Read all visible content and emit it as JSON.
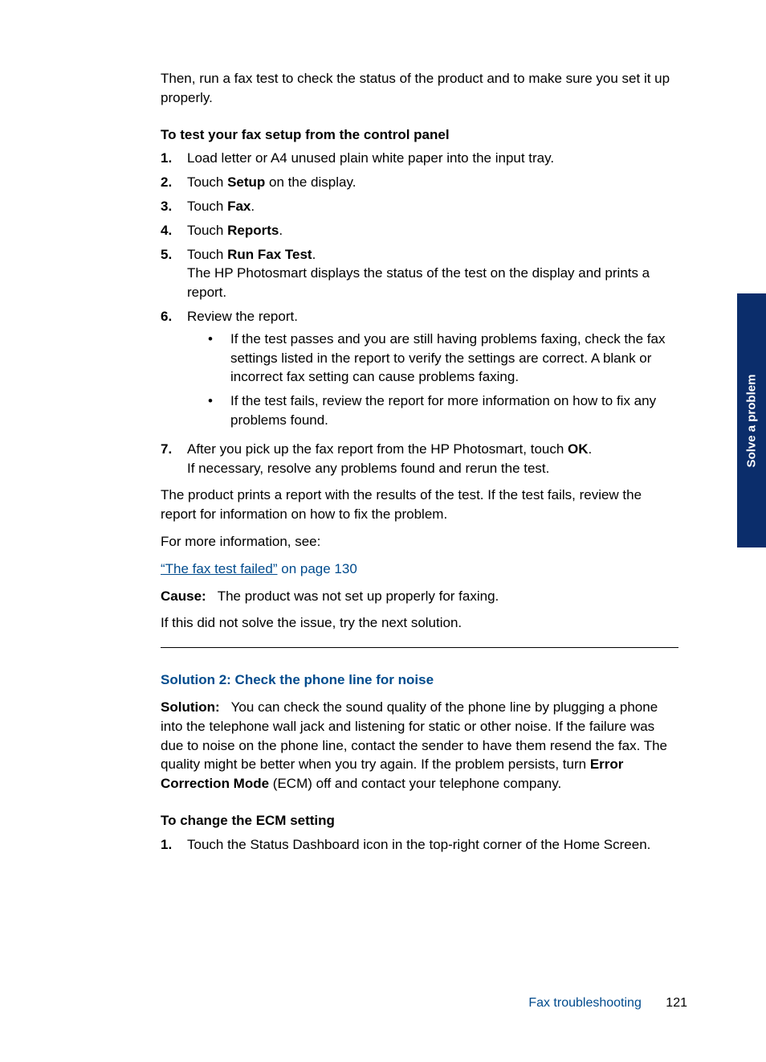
{
  "intro": "Then, run a fax test to check the status of the product and to make sure you set it up properly.",
  "heading1": "To test your fax setup from the control panel",
  "steps": [
    {
      "num": "1.",
      "parts": [
        "Load letter or A4 unused plain white paper into the input tray."
      ]
    },
    {
      "num": "2.",
      "parts": [
        "Touch ",
        "Setup",
        " on the display."
      ]
    },
    {
      "num": "3.",
      "parts": [
        "Touch ",
        "Fax",
        "."
      ]
    },
    {
      "num": "4.",
      "parts": [
        "Touch ",
        "Reports",
        "."
      ]
    },
    {
      "num": "5.",
      "parts": [
        "Touch ",
        "Run Fax Test",
        "."
      ],
      "after": "The HP Photosmart displays the status of the test on the display and prints a report."
    },
    {
      "num": "6.",
      "parts": [
        "Review the report."
      ],
      "bullets": [
        "If the test passes and you are still having problems faxing, check the fax settings listed in the report to verify the settings are correct. A blank or incorrect fax setting can cause problems faxing.",
        "If the test fails, review the report for more information on how to fix any problems found."
      ]
    },
    {
      "num": "7.",
      "parts": [
        "After you pick up the fax report from the HP Photosmart, touch ",
        "OK",
        "."
      ],
      "after": "If necessary, resolve any problems found and rerun the test."
    }
  ],
  "after_steps1": "The product prints a report with the results of the test. If the test fails, review the report for information on how to fix the problem.",
  "after_steps2": "For more information, see:",
  "link_text": "“The fax test failed”",
  "link_suffix": " on page 130",
  "cause_label": "Cause:",
  "cause_text": "The product was not set up properly for faxing.",
  "try_next": "If this did not solve the issue, try the next solution.",
  "solution2_title": "Solution 2: Check the phone line for noise",
  "sol_label": "Solution:",
  "sol2_pre": "You can check the sound quality of the phone line by plugging a phone into the telephone wall jack and listening for static or other noise. If the failure was due to noise on the phone line, contact the sender to have them resend the fax. The quality might be better when you try again. If the problem persists, turn ",
  "sol2_bold": "Error Correction Mode",
  "sol2_post": " (ECM) off and contact your telephone company.",
  "heading2": "To change the ECM setting",
  "ecm_step_num": "1.",
  "ecm_step_text": "Touch the Status Dashboard icon in the top-right corner of the Home Screen.",
  "side_tab": "Solve a problem",
  "footer_section": "Fax troubleshooting",
  "footer_page": "121"
}
